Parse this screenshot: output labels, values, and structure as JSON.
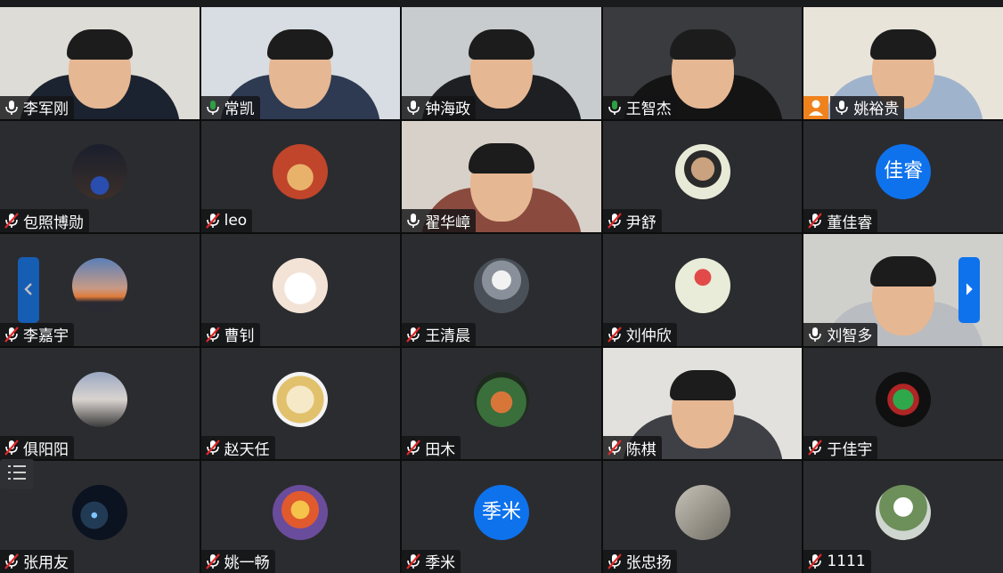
{
  "participants": [
    {
      "name": "李军刚",
      "mic": "on",
      "type": "video",
      "bg": "#dedcd6",
      "shirt": "#1b2330"
    },
    {
      "name": "常凯",
      "mic": "active",
      "type": "video",
      "bg": "#d8dde3",
      "shirt": "#2d3a52"
    },
    {
      "name": "钟海政",
      "mic": "on",
      "type": "video",
      "bg": "#c9ccce",
      "shirt": "#1d1f22"
    },
    {
      "name": "王智杰",
      "mic": "active",
      "type": "video",
      "bg": "#3a3b3f",
      "shirt": "#141414"
    },
    {
      "name": "姚裕贵",
      "mic": "on",
      "type": "video",
      "bg": "#e9e4da",
      "shirt": "#9fb3cc",
      "host": true
    },
    {
      "name": "包照博勋",
      "mic": "muted",
      "type": "avatar",
      "avatar": "night"
    },
    {
      "name": "leo",
      "mic": "muted",
      "type": "avatar",
      "avatar": "cartoon"
    },
    {
      "name": "翟华嶂",
      "mic": "on",
      "type": "video",
      "bg": "#d7d1c9",
      "shirt": "#8a4b3e"
    },
    {
      "name": "尹舒",
      "mic": "muted",
      "type": "avatar",
      "avatar": "photo"
    },
    {
      "name": "董佳睿",
      "mic": "muted",
      "type": "avatar-text",
      "avatar_text": "佳睿"
    },
    {
      "name": "李嘉宇",
      "mic": "muted",
      "type": "avatar",
      "avatar": "sunset"
    },
    {
      "name": "曹钊",
      "mic": "muted",
      "type": "avatar",
      "avatar": "cat"
    },
    {
      "name": "王清晨",
      "mic": "muted",
      "type": "avatar",
      "avatar": "astronaut"
    },
    {
      "name": "刘仲欣",
      "mic": "muted",
      "type": "avatar",
      "avatar": "flower"
    },
    {
      "name": "刘智多",
      "mic": "on",
      "type": "video",
      "bg": "#cfd0cc",
      "shirt": "#b9bcc0"
    },
    {
      "name": "俱阳阳",
      "mic": "muted",
      "type": "avatar",
      "avatar": "street"
    },
    {
      "name": "赵天任",
      "mic": "muted",
      "type": "avatar",
      "avatar": "anime"
    },
    {
      "name": "田木",
      "mic": "muted",
      "type": "avatar",
      "avatar": "fox"
    },
    {
      "name": "陈棋",
      "mic": "muted",
      "type": "video",
      "bg": "#e2e1dd",
      "shirt": "#3f4046"
    },
    {
      "name": "于佳宇",
      "mic": "muted",
      "type": "avatar",
      "avatar": "logo"
    },
    {
      "name": "张用友",
      "mic": "muted",
      "type": "avatar",
      "avatar": "space"
    },
    {
      "name": "姚一畅",
      "mic": "muted",
      "type": "avatar",
      "avatar": "luffy"
    },
    {
      "name": "季米",
      "mic": "muted",
      "type": "avatar-text",
      "avatar_text": "季米"
    },
    {
      "name": "张忠扬",
      "mic": "muted",
      "type": "avatar",
      "avatar": "girl"
    },
    {
      "name": "1111",
      "mic": "muted",
      "type": "avatar",
      "avatar": "lily"
    }
  ],
  "icons": {
    "prev_page": "chevron-left-icon",
    "next_page": "chevron-right-icon",
    "participant_list": "list-icon"
  },
  "colors": {
    "accent": "#0e72ed",
    "speaking": "#2ea043",
    "muted": "#e02828",
    "host_badge": "#f0821e"
  }
}
